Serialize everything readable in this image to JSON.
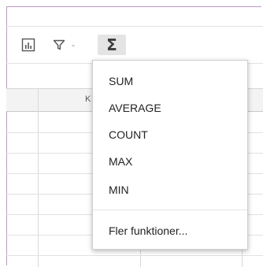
{
  "toolbar": {
    "chart_icon": "chart-icon",
    "filter_icon": "filter-icon",
    "filter_dropdown_glyph": "-",
    "function_symbol": "Σ"
  },
  "grid": {
    "column_header_fragment": "K"
  },
  "functions_menu": {
    "items": [
      "SUM",
      "AVERAGE",
      "COUNT",
      "MAX",
      "MIN"
    ],
    "more_label": "Fler funktioner..."
  }
}
